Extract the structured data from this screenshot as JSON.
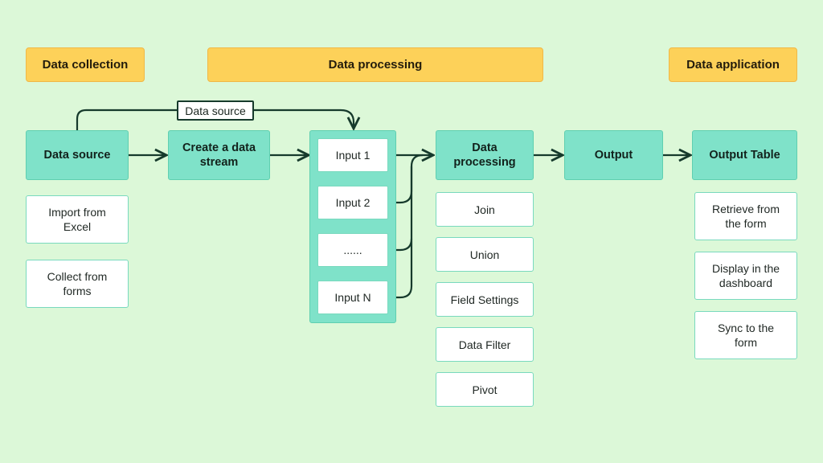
{
  "stages": {
    "collection": "Data collection",
    "processing": "Data processing",
    "application": "Data application"
  },
  "flow": {
    "data_source": "Data source",
    "create_stream": "Create a data stream",
    "data_processing": "Data processing",
    "output": "Output",
    "output_table": "Output Table"
  },
  "source_tag": "Data source",
  "inputs": [
    "Input 1",
    "Input 2",
    "......",
    "Input N"
  ],
  "collection_options": [
    "Import from Excel",
    "Collect from forms"
  ],
  "processing_options": [
    "Join",
    "Union",
    "Field Settings",
    "Data Filter",
    "Pivot"
  ],
  "application_options": [
    "Retrieve from the form",
    "Display in the dashboard",
    "Sync to the form"
  ],
  "colors": {
    "background": "#dcf8d8",
    "stage": "#fdd159",
    "node": "#7fe2c9",
    "line": "#163a2c"
  }
}
